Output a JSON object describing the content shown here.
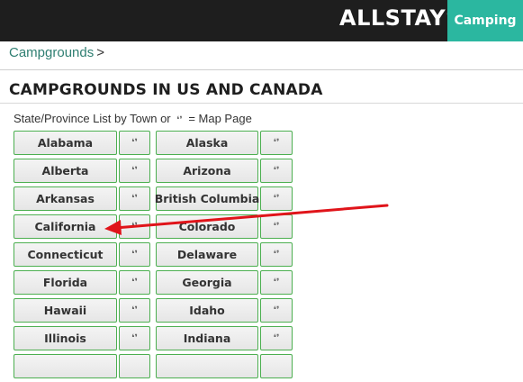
{
  "header": {
    "brand": "ALLSTAYS",
    "camping_tab": "Camping"
  },
  "breadcrumb": {
    "link": "Campgrounds",
    "separator": ">"
  },
  "page_title": "CAMPGROUNDS IN US AND CANADA",
  "legend": {
    "prefix": "State/Province List by Town or",
    "icon": "map-pin-icon",
    "suffix": "= Map Page"
  },
  "map_glyph": "❛❜",
  "states": [
    [
      "Alabama",
      "Alaska"
    ],
    [
      "Alberta",
      "Arizona"
    ],
    [
      "Arkansas",
      "British Columbia"
    ],
    [
      "California",
      "Colorado"
    ],
    [
      "Connecticut",
      "Delaware"
    ],
    [
      "Florida",
      "Georgia"
    ],
    [
      "Hawaii",
      "Idaho"
    ],
    [
      "Illinois",
      "Indiana"
    ],
    [
      "",
      ""
    ]
  ],
  "colors": {
    "accent": "#2bb7a0",
    "button_border": "#4caf50",
    "arrow": "#e0141a",
    "topbar": "#1e1e1e"
  }
}
